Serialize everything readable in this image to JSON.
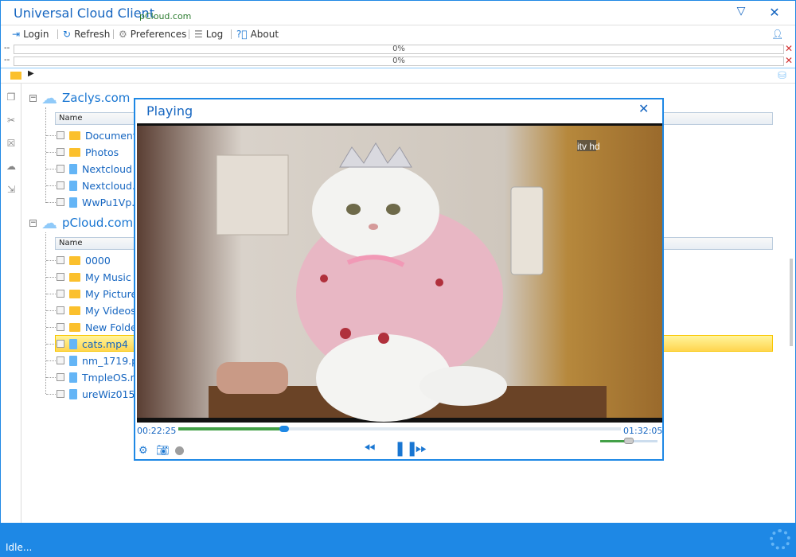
{
  "window": {
    "title": "Universal Cloud Client",
    "subtitle": "pCloud.com"
  },
  "toolbar": {
    "login": "Login",
    "refresh": "Refresh",
    "preferences": "Preferences",
    "log": "Log",
    "about": "About"
  },
  "progress": [
    {
      "dash": "--",
      "label": "0%",
      "value": 0
    },
    {
      "dash": "--",
      "label": "0%",
      "value": 0
    }
  ],
  "tree": {
    "roots": [
      {
        "label": "Zaclys.com",
        "column": "Name",
        "items": [
          {
            "name": "Documents",
            "kind": "folder"
          },
          {
            "name": "Photos",
            "kind": "folder"
          },
          {
            "name": "Nextcloud",
            "kind": "file"
          },
          {
            "name": "Nextcloud.",
            "kind": "file"
          },
          {
            "name": "WwPu1Vp.",
            "kind": "file"
          }
        ]
      },
      {
        "label": "pCloud.com",
        "column": "Name",
        "items": [
          {
            "name": "0000",
            "kind": "folder"
          },
          {
            "name": "My Music",
            "kind": "folder"
          },
          {
            "name": "My Picture",
            "kind": "folder"
          },
          {
            "name": "My Videos",
            "kind": "folder"
          },
          {
            "name": "New Folde",
            "kind": "folder"
          },
          {
            "name": "cats.mp4",
            "kind": "file",
            "selected": true
          },
          {
            "name": "nm_1719.p",
            "kind": "file"
          },
          {
            "name": "TmpleOS.n",
            "kind": "file"
          },
          {
            "name": "ureWiz015",
            "kind": "file"
          }
        ]
      }
    ]
  },
  "player": {
    "title": "Playing",
    "current_time": "00:22:25",
    "total_time": "01:32:05",
    "progress_fraction": 0.24,
    "volume_fraction": 0.5,
    "watermark": "itv hd"
  },
  "status": {
    "text": "Idle..."
  },
  "colors": {
    "accent": "#1e88e5",
    "selection": "#ffd54f",
    "folder": "#fbc02d"
  },
  "icons": [
    "login-icon",
    "refresh-icon",
    "gear-icon",
    "log-icon",
    "help-icon",
    "user-icon",
    "close-icon",
    "collapse-icon",
    "folder-icon",
    "cloud-icon"
  ]
}
